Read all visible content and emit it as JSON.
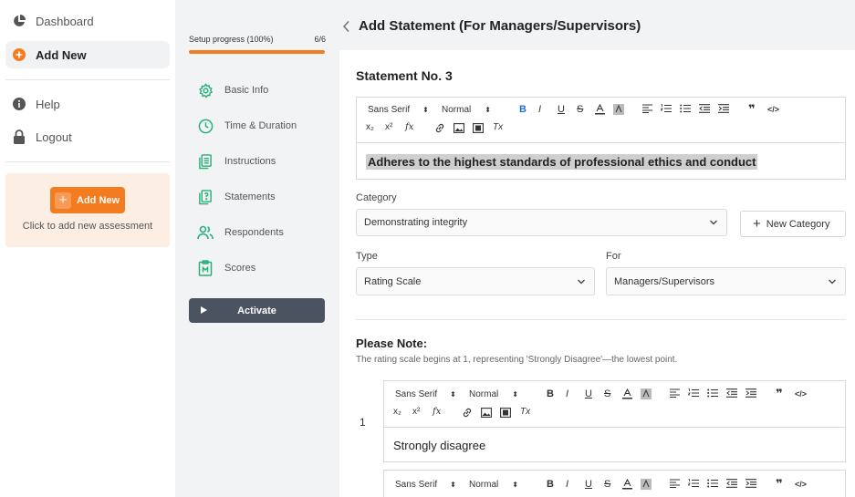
{
  "sidebar": {
    "items": [
      {
        "label": "Dashboard",
        "icon": "pie-chart-icon"
      },
      {
        "label": "Add New",
        "icon": "orange-plus-icon"
      },
      {
        "label": "Help",
        "icon": "info-icon"
      },
      {
        "label": "Logout",
        "icon": "lock-icon"
      }
    ],
    "promo": {
      "button_label": "Add New",
      "text": "Click to add new assessment"
    }
  },
  "setup": {
    "progress_label": "Setup progress (100%)",
    "progress_count": "6/6",
    "progress_value": 1.0,
    "steps": [
      {
        "label": "Basic Info",
        "icon": "gear-icon"
      },
      {
        "label": "Time & Duration",
        "icon": "clock-icon"
      },
      {
        "label": "Instructions",
        "icon": "document-icon"
      },
      {
        "label": "Statements",
        "icon": "question-box-icon"
      },
      {
        "label": "Respondents",
        "icon": "people-icon"
      },
      {
        "label": "Scores",
        "icon": "clipboard-icon"
      }
    ],
    "activate_label": "Activate"
  },
  "page": {
    "title": "Add Statement (For Managers/Supervisors)"
  },
  "statement": {
    "title": "Statement No. 3",
    "text": "Adheres to the highest standards of professional ethics and conduct"
  },
  "toolbar": {
    "font": "Sans Serif",
    "size": "Normal",
    "bold": "B",
    "italic": "I",
    "underline": "U",
    "strike": "S",
    "quote": "❞",
    "code": "</>",
    "subscript": "x₂",
    "superscript": "x²",
    "formula": "fx",
    "clean": "Tx"
  },
  "form": {
    "category_label": "Category",
    "category_value": "Demonstrating integrity",
    "new_category_label": "New Category",
    "type_label": "Type",
    "type_value": "Rating Scale",
    "for_label": "For",
    "for_value": "Managers/Supervisors"
  },
  "note": {
    "title": "Please Note:",
    "text": "The rating scale begins at 1, representing 'Strongly Disagree'—the lowest point."
  },
  "scale": [
    {
      "number": "1",
      "text": "Strongly disagree"
    }
  ],
  "colors": {
    "accent": "#f47c20",
    "teal": "#27b07a",
    "activate": "#4b5260"
  }
}
